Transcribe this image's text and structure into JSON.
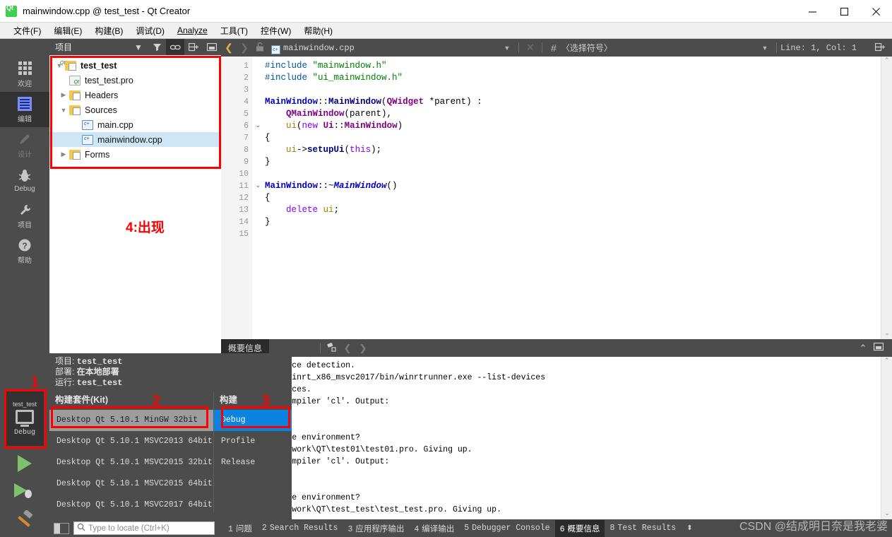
{
  "window": {
    "title": "mainwindow.cpp @ test_test - Qt Creator",
    "logo": "qt-logo",
    "minimize": "−",
    "maximize": "□",
    "close": "✕"
  },
  "menubar": [
    {
      "label": "文件(F)"
    },
    {
      "label": "编辑(E)"
    },
    {
      "label": "构建(B)"
    },
    {
      "label": "调试(D)"
    },
    {
      "label": "Analyze"
    },
    {
      "label": "工具(T)"
    },
    {
      "label": "控件(W)"
    },
    {
      "label": "帮助(H)"
    }
  ],
  "modebar": [
    {
      "label": "欢迎",
      "icon": "grid-icon",
      "state": "normal"
    },
    {
      "label": "编辑",
      "icon": "document-icon",
      "state": "active"
    },
    {
      "label": "设计",
      "icon": "pencil-icon",
      "state": "disabled"
    },
    {
      "label": "Debug",
      "icon": "bug-icon",
      "state": "normal"
    },
    {
      "label": "项目",
      "icon": "wrench-icon",
      "state": "normal"
    },
    {
      "label": "帮助",
      "icon": "question-icon",
      "state": "normal"
    }
  ],
  "kit_button": {
    "project": "test_test",
    "config": "Debug",
    "icon": "monitor-icon",
    "annotation": "1"
  },
  "run_buttons": [
    {
      "name": "run-button",
      "icon": "play-icon"
    },
    {
      "name": "debug-button",
      "icon": "play-bug-icon"
    },
    {
      "name": "build-button",
      "icon": "hammer-icon"
    }
  ],
  "project_panel": {
    "title": "项目",
    "toolbar": [
      {
        "name": "filter-icon",
        "glyph": "▼"
      },
      {
        "name": "sync-icon",
        "glyph": "⛓"
      },
      {
        "name": "split-icon",
        "glyph": "⊟+"
      },
      {
        "name": "dock-icon",
        "glyph": "▣"
      }
    ],
    "tree": [
      {
        "depth": 0,
        "arrow": "v",
        "icon": "qt-project-icon",
        "label": "test_test",
        "bold": true,
        "selected": false
      },
      {
        "depth": 1,
        "arrow": "",
        "icon": "pro-file-icon",
        "label": "test_test.pro",
        "bold": false,
        "selected": false
      },
      {
        "depth": 1,
        "arrow": ">",
        "icon": "folder-h-icon",
        "label": "Headers",
        "bold": false,
        "selected": false
      },
      {
        "depth": 1,
        "arrow": "v",
        "icon": "folder-cpp-icon",
        "label": "Sources",
        "bold": false,
        "selected": false
      },
      {
        "depth": 2,
        "arrow": "",
        "icon": "cpp-file-icon",
        "label": "main.cpp",
        "bold": false,
        "selected": false
      },
      {
        "depth": 2,
        "arrow": "",
        "icon": "cpp-file-icon",
        "label": "mainwindow.cpp",
        "bold": false,
        "selected": true
      },
      {
        "depth": 1,
        "arrow": ">",
        "icon": "folder-forms-icon",
        "label": "Forms",
        "bold": false,
        "selected": false
      }
    ],
    "annotation": "4:出现"
  },
  "editor": {
    "toolbar": {
      "back": "❮",
      "forward": "❯",
      "lock": "lock-open-icon",
      "file_icon": "cpp-file-icon",
      "filename": "mainwindow.cpp",
      "dropdown": "▼",
      "close": "✕",
      "hash": "#",
      "symbol_placeholder": "〈选择符号〉",
      "symbol_dropdown": "▼",
      "position": "Line: 1, Col: 1",
      "split": "⊟+"
    },
    "lines": [
      {
        "n": 1,
        "fold": "",
        "html": "<span class=\"pre\">#include</span> <span class=\"str\">\"mainwindow.h\"</span>"
      },
      {
        "n": 2,
        "fold": "",
        "html": "<span class=\"pre\">#include</span> <span class=\"str\">\"ui_mainwindow.h\"</span>"
      },
      {
        "n": 3,
        "fold": "",
        "html": ""
      },
      {
        "n": 4,
        "fold": "",
        "html": "<span class=\"cls\">MainWindow</span>::<span class=\"fn\">MainWindow</span>(<span class=\"typ\">QWidget</span> *parent) :"
      },
      {
        "n": 5,
        "fold": "",
        "html": "    <span class=\"typ\">QMainWindow</span>(parent),"
      },
      {
        "n": 6,
        "fold": "v",
        "html": "    <span class=\"vb\">ui</span>(<span class=\"kw\">new</span> <span class=\"typ\">Ui</span>::<span class=\"typ\">MainWindow</span>)"
      },
      {
        "n": 7,
        "fold": "",
        "html": "{"
      },
      {
        "n": 8,
        "fold": "",
        "html": "    <span class=\"vb\">ui</span>-&gt;<span class=\"fn\">setupUi</span>(<span class=\"kw\">this</span>);"
      },
      {
        "n": 9,
        "fold": "",
        "html": "}"
      },
      {
        "n": 10,
        "fold": "",
        "html": ""
      },
      {
        "n": 11,
        "fold": "v",
        "html": "<span class=\"cls\">MainWindow</span>::~<span class=\"ital\">MainWindow</span>()"
      },
      {
        "n": 12,
        "fold": "",
        "html": "{"
      },
      {
        "n": 13,
        "fold": "",
        "html": "    <span class=\"kw\">delete</span> <span class=\"vb\">ui</span>;"
      },
      {
        "n": 14,
        "fold": "",
        "html": "}"
      },
      {
        "n": 15,
        "fold": "",
        "html": ""
      }
    ]
  },
  "output_panel": {
    "tab": "概要信息",
    "icons": [
      {
        "name": "clear-icon",
        "glyph": "🧹"
      },
      {
        "name": "prev-icon",
        "glyph": "❮"
      },
      {
        "name": "next-icon",
        "glyph": "❯"
      },
      {
        "name": "collapse-icon",
        "glyph": "⌃"
      },
      {
        "name": "maximize-icon",
        "glyph": "▣"
      }
    ],
    "lines": [
      "Running Windows Runtime device detection.",
      "D:/Program Files/QT/5.10.1/winrt_x86_msvc2017/bin/winrtrunner.exe --list-devices",
      "Found 5 Windows Runtime devices.",
      "Project ERROR: Cannot run compiler 'cl'. Output:",
      "===================",
      "===================",
      "Maybe you forgot to setup the environment?",
      "Error while parsing file D:\\work\\QT\\test01\\test01.pro. Giving up.",
      "Project ERROR: Cannot run compiler 'cl'. Output:",
      "===================",
      "===================",
      "Maybe you forgot to setup the environment?",
      "Error while parsing file D:\\work\\QT\\test_test\\test_test.pro. Giving up."
    ]
  },
  "kit_popup": {
    "info": [
      {
        "label": "项目: ",
        "value": "test_test"
      },
      {
        "label": "部署: ",
        "value": "在本地部署"
      },
      {
        "label": "运行: ",
        "value": "test_test"
      }
    ],
    "kit_column": {
      "title": "构建套件(Kit)",
      "annotation": "2",
      "items": [
        {
          "label": "Desktop Qt 5.10.1 MinGW 32bit",
          "state": "highlight"
        },
        {
          "label": "Desktop Qt 5.10.1 MSVC2013 64bit",
          "state": "normal"
        },
        {
          "label": "Desktop Qt 5.10.1 MSVC2015 32bit",
          "state": "normal"
        },
        {
          "label": "Desktop Qt 5.10.1 MSVC2015 64bit",
          "state": "normal"
        },
        {
          "label": "Desktop Qt 5.10.1 MSVC2017 64bit",
          "state": "normal"
        }
      ]
    },
    "build_column": {
      "title": "构建",
      "annotation": "3",
      "items": [
        {
          "label": "Debug",
          "state": "selected"
        },
        {
          "label": "Profile",
          "state": "normal"
        },
        {
          "label": "Release",
          "state": "normal"
        }
      ]
    }
  },
  "statusbar": {
    "toggle_icon": "sidebar-toggle-icon",
    "locator_placeholder": "Type to locate (Ctrl+K)",
    "search_icon": "search-icon",
    "tabs": [
      {
        "n": "1",
        "label": "问题",
        "active": false
      },
      {
        "n": "2",
        "label": "Search Results",
        "active": false
      },
      {
        "n": "3",
        "label": "应用程序输出",
        "active": false
      },
      {
        "n": "4",
        "label": "编译输出",
        "active": false
      },
      {
        "n": "5",
        "label": "Debugger Console",
        "active": false
      },
      {
        "n": "6",
        "label": "概要信息",
        "active": true
      },
      {
        "n": "8",
        "label": "Test Results",
        "active": false
      }
    ],
    "updown": "⬍"
  },
  "watermark": "CSDN @结成明日奈是我老婆",
  "colors": {
    "accent_blue": "#0a84e0",
    "annotation_red": "#ff0000",
    "panel_dark": "#4c4c4c",
    "mode_active": "#333333",
    "selection_blue": "#cfe6f7"
  }
}
